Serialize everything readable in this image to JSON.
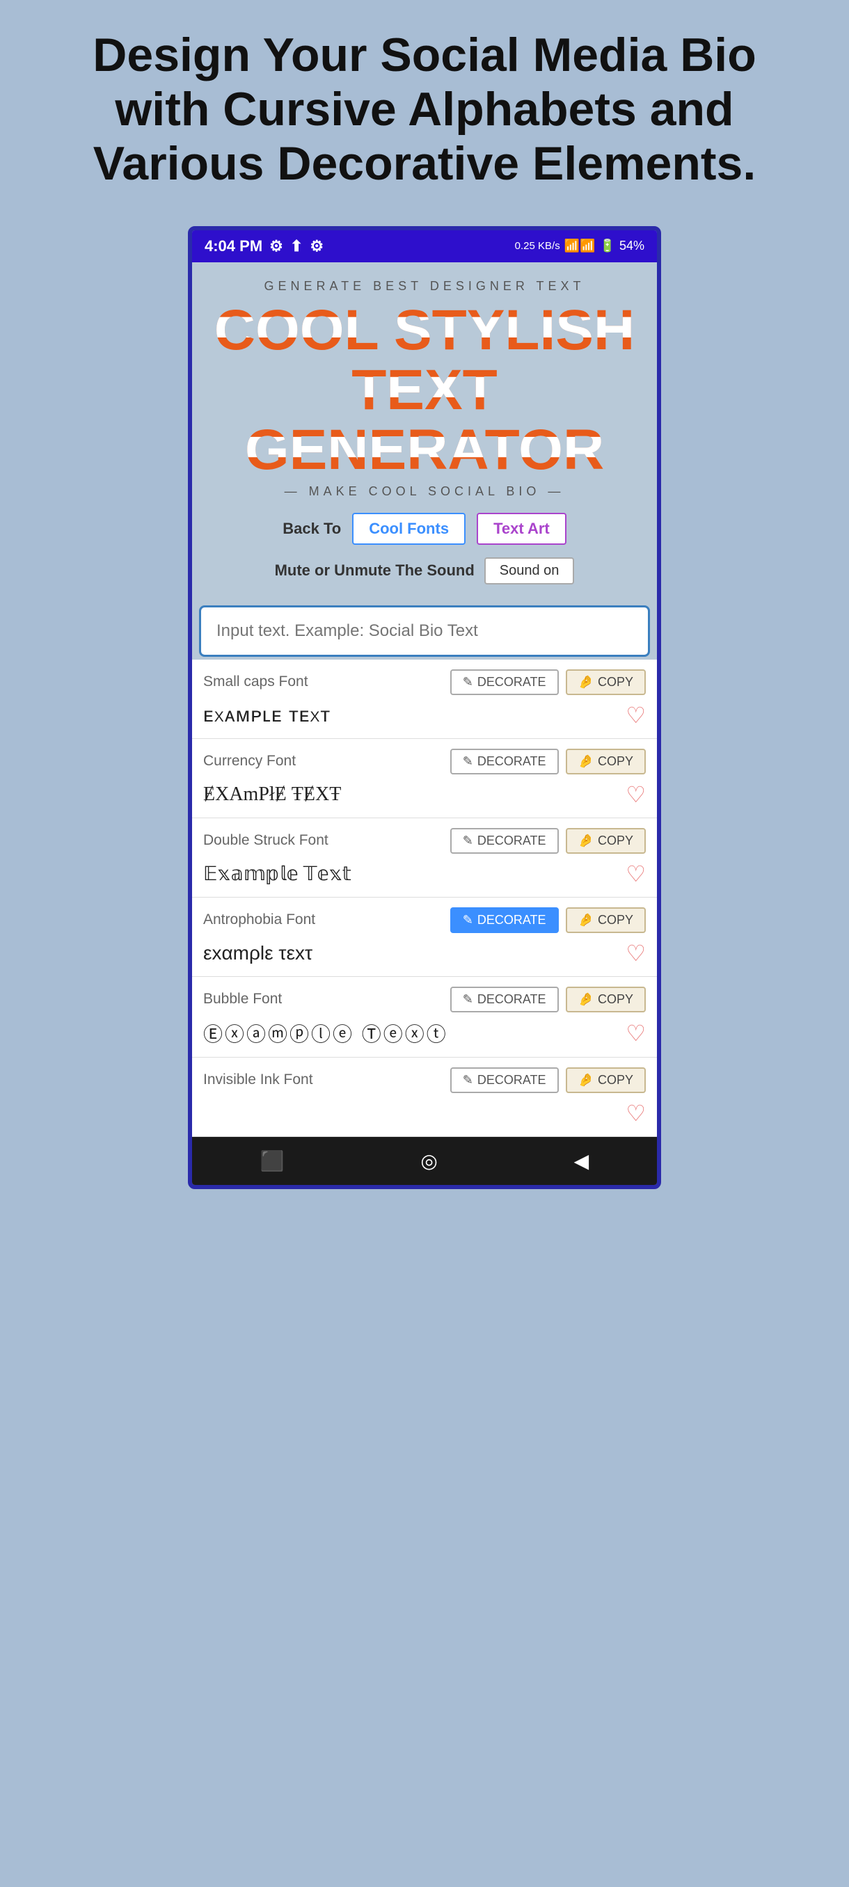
{
  "headline": "Design Your Social Media Bio with Cursive Alphabets and Various Decorative Elements.",
  "status_bar": {
    "time": "4:04 PM",
    "battery": "54%"
  },
  "app": {
    "subtitle": "GENERATE BEST DESIGNER TEXT",
    "title_lines": [
      "COOL STYLISH",
      "TEXT",
      "GENERATOR"
    ],
    "tagline": "— MAKE COOL SOCIAL BIO —",
    "back_to_label": "Back To",
    "cool_fonts_btn": "Cool Fonts",
    "text_art_btn": "Text Art",
    "mute_label": "Mute or Unmute The Sound",
    "sound_btn": "Sound on",
    "input_placeholder": "Input text. Example: Social Bio Text",
    "fonts": [
      {
        "name": "Small caps Font",
        "preview": "ᴇxᴀᴍᴘʟᴇ ᴛᴇxᴛ",
        "decorate_label": "DECORATE",
        "copy_label": "COPY",
        "active": false
      },
      {
        "name": "Currency Font",
        "preview": "ɆXAmPłɆ ŦɆXŦ",
        "decorate_label": "DECORATE",
        "copy_label": "COPY",
        "active": false
      },
      {
        "name": "Double Struck Font",
        "preview": "𝔼𝕩𝕒𝕞𝕡𝕝𝕖 𝕋𝕖𝕩𝕥",
        "decorate_label": "DECORATE",
        "copy_label": "COPY",
        "active": false
      },
      {
        "name": "Antrophobia Font",
        "preview": "εxαmρlε τεxτ",
        "decorate_label": "DECORATE",
        "copy_label": "COPY",
        "active": true
      },
      {
        "name": "Bubble Font",
        "preview": "⒠⒳⒜⒨⒫⒧⒠ ⒯⒠⒳⒯",
        "decorate_label": "DECORATE",
        "copy_label": "COPY",
        "active": false
      },
      {
        "name": "Invisible Ink Font",
        "preview": "",
        "decorate_label": "DECORATE",
        "copy_label": "COPY",
        "active": false
      }
    ]
  },
  "icons": {
    "decorate": "✎",
    "copy": "🤌",
    "heart": "♡",
    "home": "⬛",
    "circle": "◎",
    "back": "◀"
  }
}
